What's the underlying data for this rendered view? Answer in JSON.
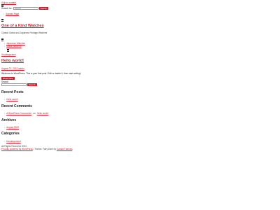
{
  "header": {
    "skip_link": "Skip to content",
    "search_label": "Search for:",
    "search_placeholder": "Search",
    "search_button": "Search",
    "nav_items": [
      "Sample Page"
    ],
    "site_title": "One of a Kind Watches",
    "tagline": "Classic Swiss and Japanese Vintage Watches",
    "secondary_nav": [
      "Japanese Watches",
      "Swiss Watches"
    ],
    "category_link": "Uncategorized"
  },
  "post": {
    "title": "Hello world!",
    "meta": "August 22, 2022 admin",
    "excerpt": "Welcome to WordPress. This is your first post. Edit or delete it, then start writing!",
    "button": "Read More"
  },
  "sidebar": {
    "search_label": "Search",
    "search_button": "Search",
    "recent_posts_title": "Recent Posts",
    "recent_posts": [
      "Hello world!"
    ],
    "recent_comments_title": "Recent Comments",
    "comment_author": "A WordPress Commenter",
    "comment_on": "on",
    "comment_post": "Hello world!",
    "archives_title": "Archives",
    "archives": [
      "August 2022"
    ],
    "categories_title": "Categories",
    "categories": [
      "Uncategorized"
    ]
  },
  "footer": {
    "copyright": "All Rights Reserved 2022.",
    "powered_link": "Proudly powered by WordPress",
    "separator": " | Theme: Fairy Dark by ",
    "theme_link": "Candid Themes",
    "end": "."
  },
  "colors": {
    "accent": "#c51f2f",
    "text": "#222222"
  }
}
